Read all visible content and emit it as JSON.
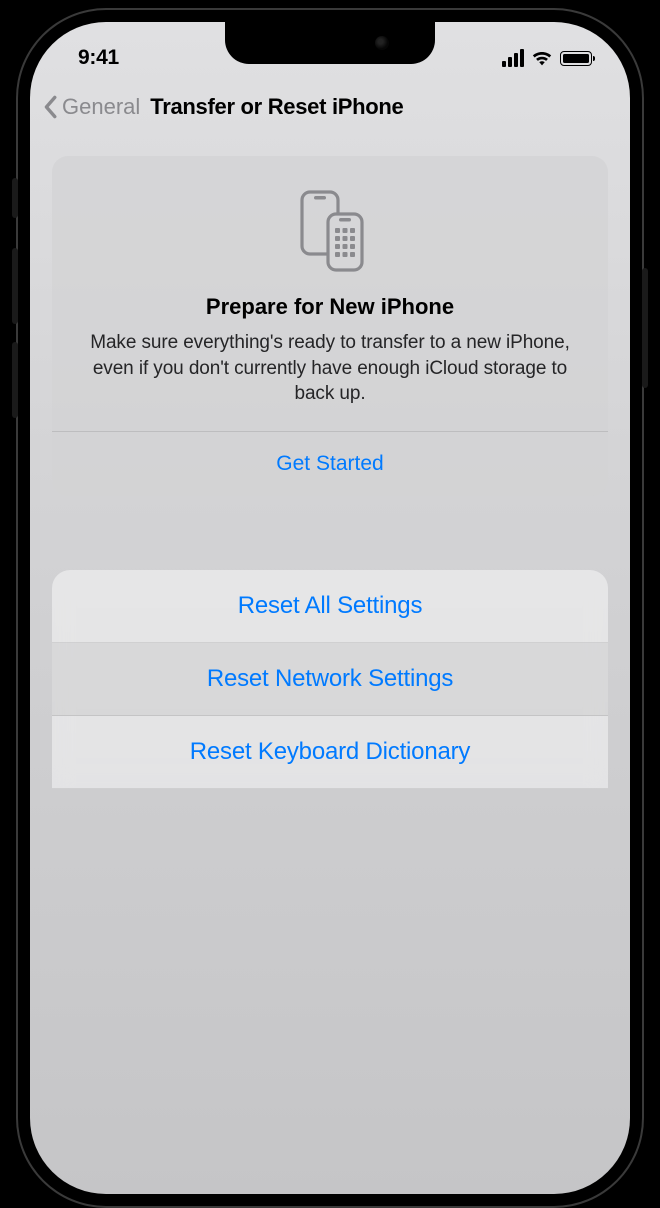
{
  "status": {
    "time": "9:41"
  },
  "nav": {
    "back_label": "General",
    "title": "Transfer or Reset iPhone"
  },
  "prepare": {
    "title": "Prepare for New iPhone",
    "description": "Make sure everything's ready to transfer to a new iPhone, even if you don't currently have enough iCloud storage to back up.",
    "cta": "Get Started"
  },
  "reset_options": [
    {
      "label": "Reset All Settings",
      "highlighted": false
    },
    {
      "label": "Reset Network Settings",
      "highlighted": true
    },
    {
      "label": "Reset Keyboard Dictionary",
      "highlighted": false
    }
  ],
  "colors": {
    "link": "#007aff",
    "background": "#d6d6d8"
  }
}
